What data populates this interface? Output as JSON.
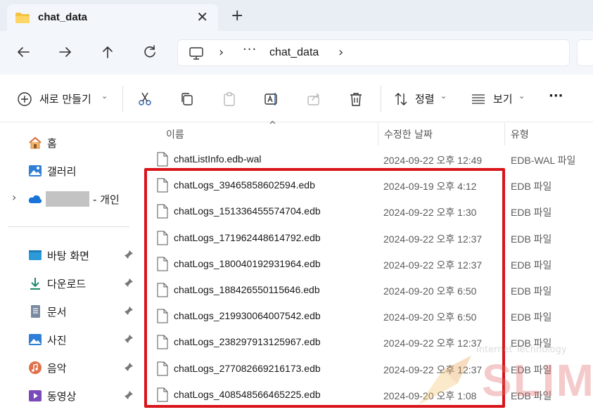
{
  "window": {
    "tab_title": "chat_data",
    "new_tab": "+",
    "close_tab": "✕"
  },
  "address": {
    "overflow": "···",
    "crumb": "chat_data",
    "sep": "›"
  },
  "toolbar": {
    "new_label": "새로 만들기",
    "sort_label": "정렬",
    "view_label": "보기",
    "more": "···",
    "chevron": "⌄"
  },
  "sidebar": {
    "home": "홈",
    "gallery": "갤러리",
    "onedrive_suffix": "- 개인",
    "expand": "›",
    "pinned": [
      {
        "label": "바탕 화면",
        "icon": "desktop-icon"
      },
      {
        "label": "다운로드",
        "icon": "download-icon"
      },
      {
        "label": "문서",
        "icon": "document-icon"
      },
      {
        "label": "사진",
        "icon": "pictures-icon"
      },
      {
        "label": "음악",
        "icon": "music-icon"
      },
      {
        "label": "동영상",
        "icon": "video-icon"
      }
    ]
  },
  "columns": {
    "name": "이름",
    "date": "수정한 날짜",
    "type": "유형",
    "sort_caret": "^"
  },
  "files": [
    {
      "name": "chatListInfo.edb-wal",
      "date": "2024-09-22 오후 12:49",
      "type": "EDB-WAL 파일"
    },
    {
      "name": "chatLogs_39465858602594.edb",
      "date": "2024-09-19 오후 4:12",
      "type": "EDB 파일"
    },
    {
      "name": "chatLogs_151336455574704.edb",
      "date": "2024-09-22 오후 1:30",
      "type": "EDB 파일"
    },
    {
      "name": "chatLogs_171962448614792.edb",
      "date": "2024-09-22 오후 12:37",
      "type": "EDB 파일"
    },
    {
      "name": "chatLogs_180040192931964.edb",
      "date": "2024-09-22 오후 12:37",
      "type": "EDB 파일"
    },
    {
      "name": "chatLogs_188426550115646.edb",
      "date": "2024-09-20 오후 6:50",
      "type": "EDB 파일"
    },
    {
      "name": "chatLogs_219930064007542.edb",
      "date": "2024-09-20 오후 6:50",
      "type": "EDB 파일"
    },
    {
      "name": "chatLogs_238297913125967.edb",
      "date": "2024-09-22 오후 12:37",
      "type": "EDB 파일"
    },
    {
      "name": "chatLogs_277082669216173.edb",
      "date": "2024-09-22 오후 12:37",
      "type": "EDB 파일"
    },
    {
      "name": "chatLogs_408548566465225.edb",
      "date": "2024-09-20 오후 1:08",
      "type": "EDB 파일"
    }
  ],
  "watermark": {
    "line": "Internet Technology",
    "big": "SLIM"
  },
  "colors": {
    "highlight": "#d9141a",
    "accent": "#1e6fd9"
  }
}
